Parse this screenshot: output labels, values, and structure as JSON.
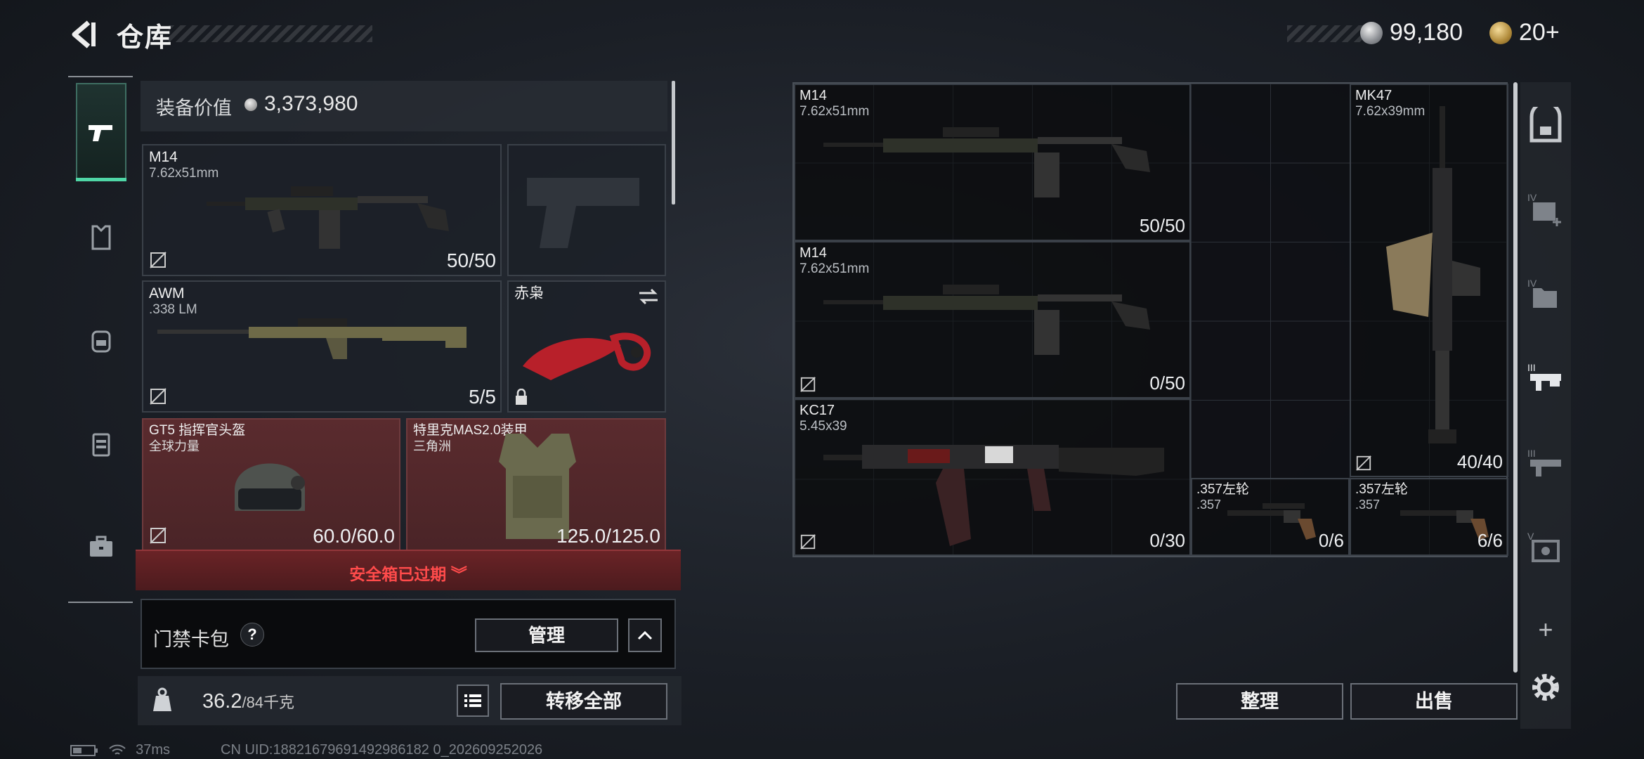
{
  "header": {
    "title": "仓库",
    "currency1": "99,180",
    "currency2": "20+"
  },
  "left_panel": {
    "value_label": "装备价值",
    "value": "3,373,980",
    "slots": [
      {
        "name": "M14",
        "caliber": "7.62x51mm",
        "ammo": "50/50"
      },
      {
        "name": "AWM",
        "caliber": ".338 LM",
        "ammo": "5/5"
      },
      {
        "name": "赤枭"
      },
      {
        "name": "GT5 指挥官头盔",
        "sub": "全球力量",
        "ammo": "60.0/60.0"
      },
      {
        "name": "特里克MAS2.0装甲",
        "sub": "三角洲",
        "ammo": "125.0/125.0"
      }
    ],
    "warning": "安全箱已过期",
    "card_label": "门禁卡包",
    "card_help": "?",
    "manage": "管理",
    "collapse": "^",
    "weight": "36.2",
    "weight_max": "/84千克",
    "transfer_all": "转移全部"
  },
  "grid": {
    "items": [
      {
        "name": "M14",
        "caliber": "7.62x51mm",
        "ammo": "50/50"
      },
      {
        "name": "M14",
        "caliber": "7.62x51mm",
        "ammo": "0/50"
      },
      {
        "name": "KC17",
        "caliber": "5.45x39",
        "ammo": "0/30"
      },
      {
        "name": "MK47",
        "caliber": "7.62x39mm",
        "ammo": "40/40"
      },
      {
        "name": ".357左轮",
        "caliber": ".357",
        "ammo": "0/6"
      },
      {
        "name": ".357左轮",
        "caliber": ".357",
        "ammo": "6/6"
      }
    ]
  },
  "bottom": {
    "sort": "整理",
    "sell": "出售"
  },
  "status": {
    "ping": "37ms",
    "uid": "CN UID:18821679691492986182 0_202609252026"
  },
  "right_nav": {
    "plus": "+"
  }
}
